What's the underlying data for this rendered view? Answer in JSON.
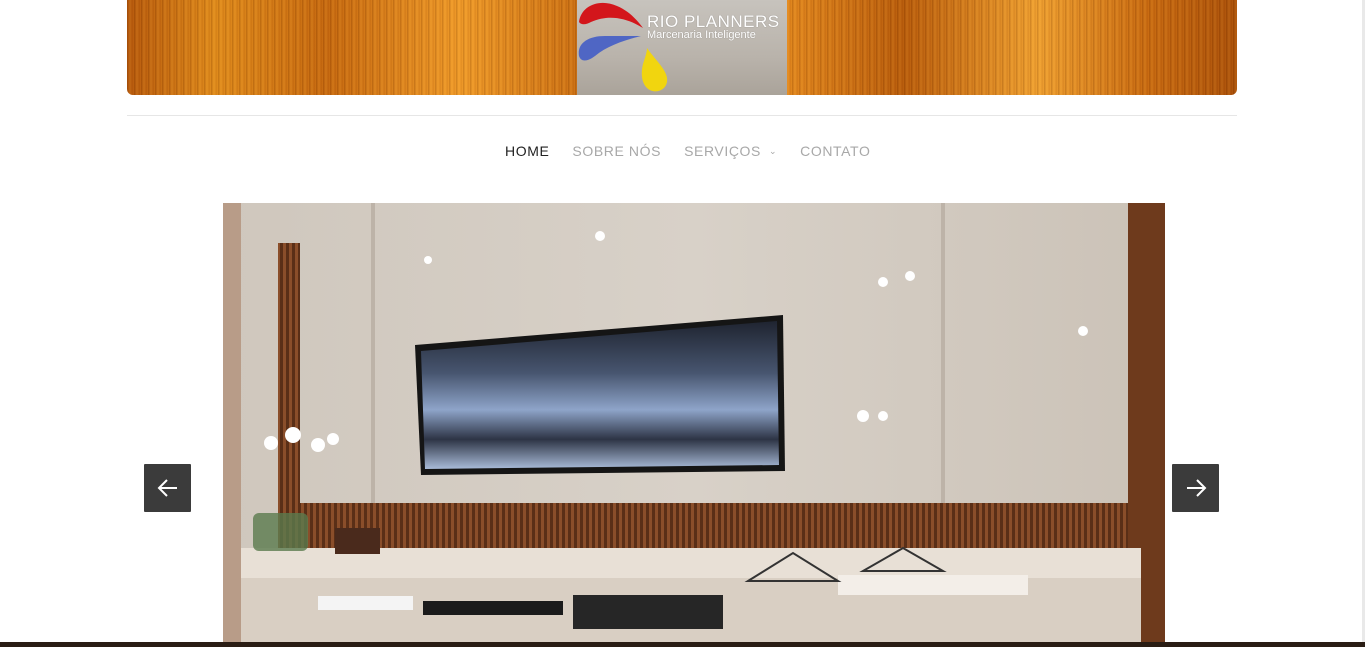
{
  "header": {
    "logo_title": "RIO PLANNERS",
    "logo_subtitle": "Marcenaria Inteligente"
  },
  "nav": {
    "items": [
      {
        "label": "HOME",
        "active": true
      },
      {
        "label": "SOBRE NÓS",
        "active": false
      },
      {
        "label": "SERVIÇOS",
        "active": false,
        "has_dropdown": true
      },
      {
        "label": "CONTATO",
        "active": false
      }
    ]
  },
  "slider": {
    "prev_icon": "arrow-left-icon",
    "next_icon": "arrow-right-icon",
    "slide_image": "living-room-tv-panel-photo"
  },
  "colors": {
    "nav_active": "#222222",
    "nav_inactive": "#a8a8a8",
    "arrow_bg": "#3b3b3b",
    "banner_wood": "#e08a1a"
  }
}
